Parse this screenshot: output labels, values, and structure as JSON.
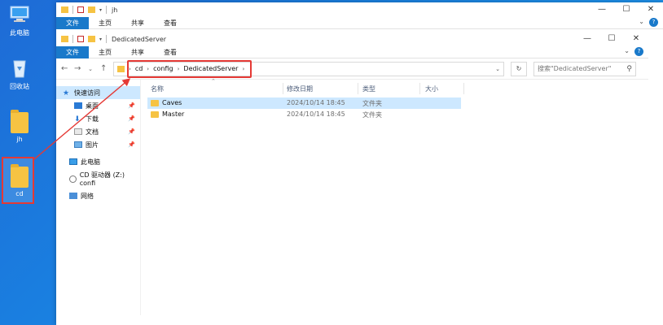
{
  "desktop": {
    "icons": [
      {
        "label": "此电脑"
      },
      {
        "label": "回收站"
      },
      {
        "label": "jh"
      },
      {
        "label": "cd"
      }
    ]
  },
  "back_window": {
    "title": "jh",
    "tabs": [
      "文件",
      "主页",
      "共享",
      "查看"
    ]
  },
  "front_window": {
    "title": "DedicatedServer",
    "tabs": [
      "文件",
      "主页",
      "共享",
      "查看"
    ],
    "address": [
      "cd",
      "config",
      "DedicatedServer"
    ],
    "search_placeholder": "搜索\"DedicatedServer\"",
    "sidebar": {
      "quick_access": "快速访问",
      "pinned": [
        "桌面",
        "下载",
        "文档",
        "图片"
      ],
      "this_pc": "此电脑",
      "cd_drive": "CD 驱动器 (Z:) confi",
      "network": "网络"
    },
    "columns": [
      "名称",
      "修改日期",
      "类型",
      "大小"
    ],
    "files": [
      {
        "name": "Caves",
        "date": "2024/10/14 18:45",
        "type": "文件夹",
        "size": ""
      },
      {
        "name": "Master",
        "date": "2024/10/14 18:45",
        "type": "文件夹",
        "size": ""
      }
    ]
  },
  "colors": {
    "accent": "#1979ca",
    "highlight": "#e53935",
    "folder": "#f6c343",
    "selection": "#cde8ff"
  }
}
